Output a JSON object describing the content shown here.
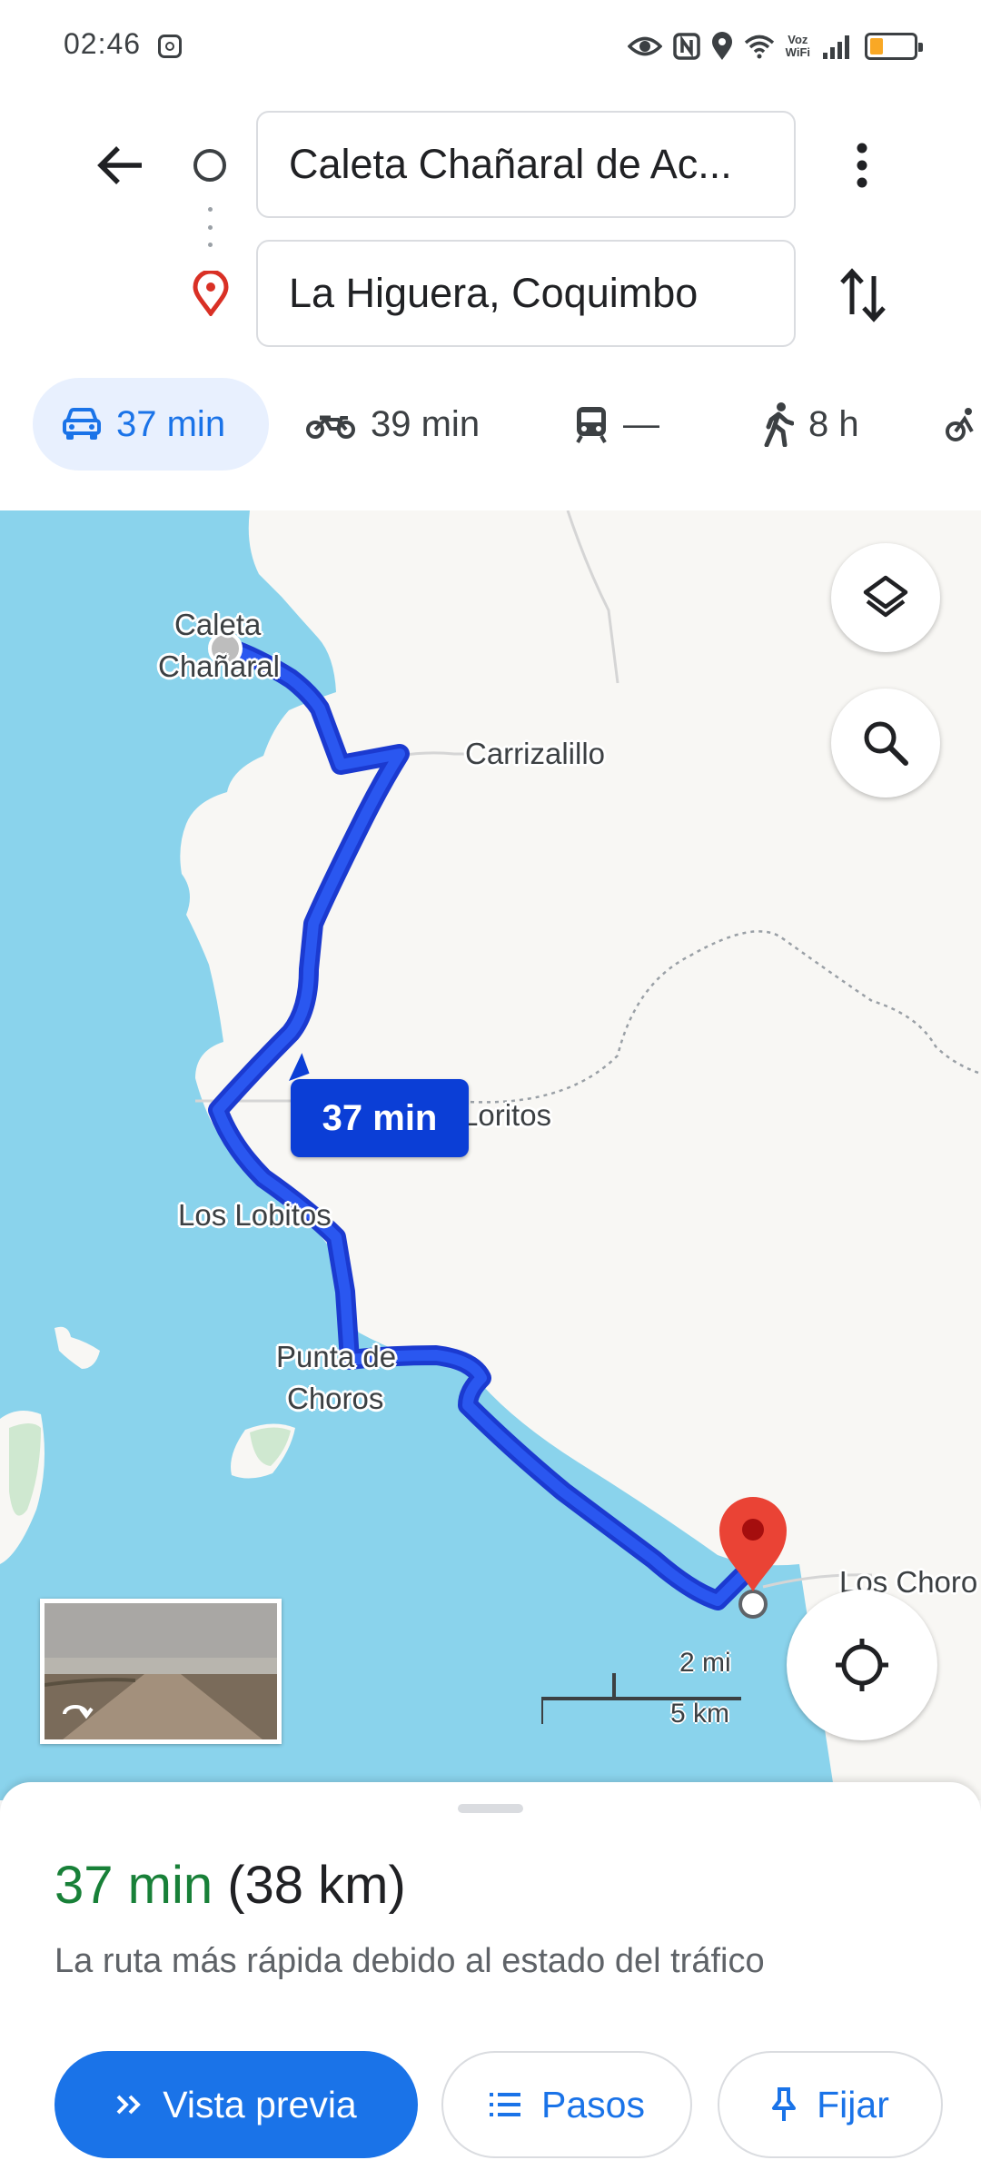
{
  "status_bar": {
    "time": "02:46",
    "voz": "Voz",
    "wifi": "WiFi",
    "battery_level": 0.3,
    "icons": [
      "camera-icon",
      "eye-icon",
      "nfc-icon",
      "location-icon",
      "wifi-icon",
      "signal-icon",
      "battery-icon"
    ]
  },
  "header": {
    "origin": "Caleta Chañaral de Ac...",
    "destination": "La Higuera, Coquimbo"
  },
  "modes": [
    {
      "icon": "car-icon",
      "label": "37 min",
      "selected": true
    },
    {
      "icon": "motorcycle-icon",
      "label": "39 min",
      "selected": false
    },
    {
      "icon": "transit-icon",
      "label": "—",
      "selected": false
    },
    {
      "icon": "walk-icon",
      "label": "8 h",
      "selected": false
    },
    {
      "icon": "bike-icon",
      "label": "",
      "selected": false
    }
  ],
  "map": {
    "places": [
      "Caleta",
      "Chañaral",
      "Carrizalillo",
      "Loritos",
      "Los Lobitos",
      "Punta de",
      "Choros",
      "Los Choro"
    ],
    "route_duration": "37 min",
    "scale": {
      "imperial": "2 mi",
      "metric": "5 km"
    },
    "colors": {
      "water": "#8ad3ec",
      "land": "#f8f7f4",
      "route": "#0b3ed6",
      "route_casing": "#2447e4",
      "pin": "#ea4335"
    }
  },
  "sheet": {
    "duration": "37 min",
    "distance": "(38 km)",
    "description": "La ruta más rápida debido al estado del tráfico",
    "buttons": {
      "preview": "Vista previa",
      "steps": "Pasos",
      "pin": "Fijar"
    },
    "colors": {
      "accent": "#1a73e8",
      "time": "#188038"
    }
  }
}
